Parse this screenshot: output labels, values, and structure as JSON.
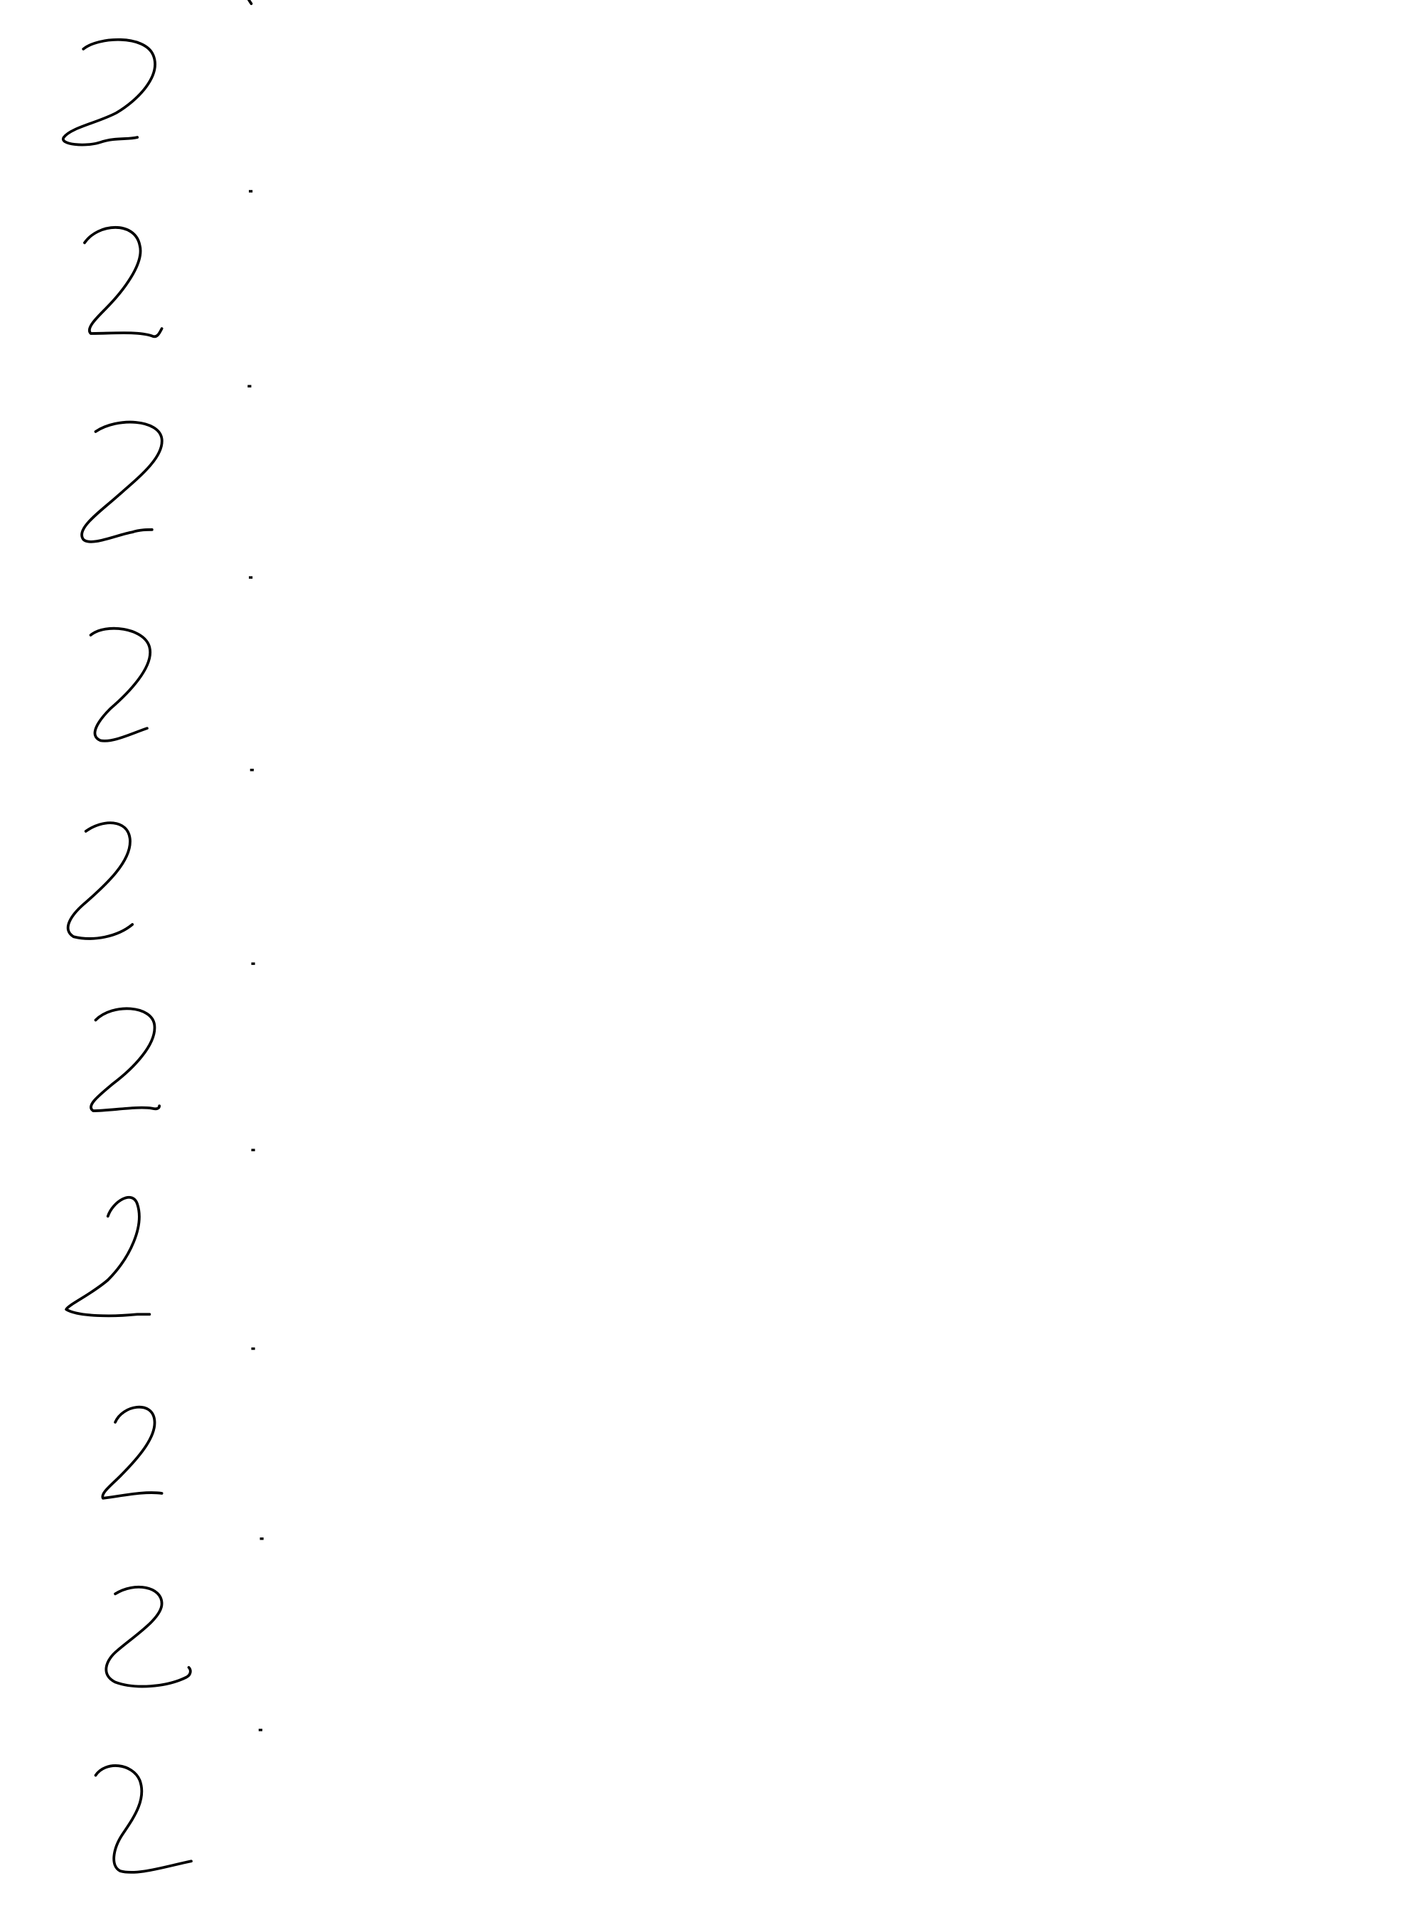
{
  "digits": [
    {
      "text": "2"
    },
    {
      "text": "2"
    },
    {
      "text": "2"
    },
    {
      "text": "2"
    },
    {
      "text": "2"
    },
    {
      "text": "2"
    },
    {
      "text": "2"
    },
    {
      "text": "2"
    },
    {
      "text": "2"
    },
    {
      "text": "2"
    }
  ],
  "ink_color": "#000000",
  "background_color": "#ffffff"
}
